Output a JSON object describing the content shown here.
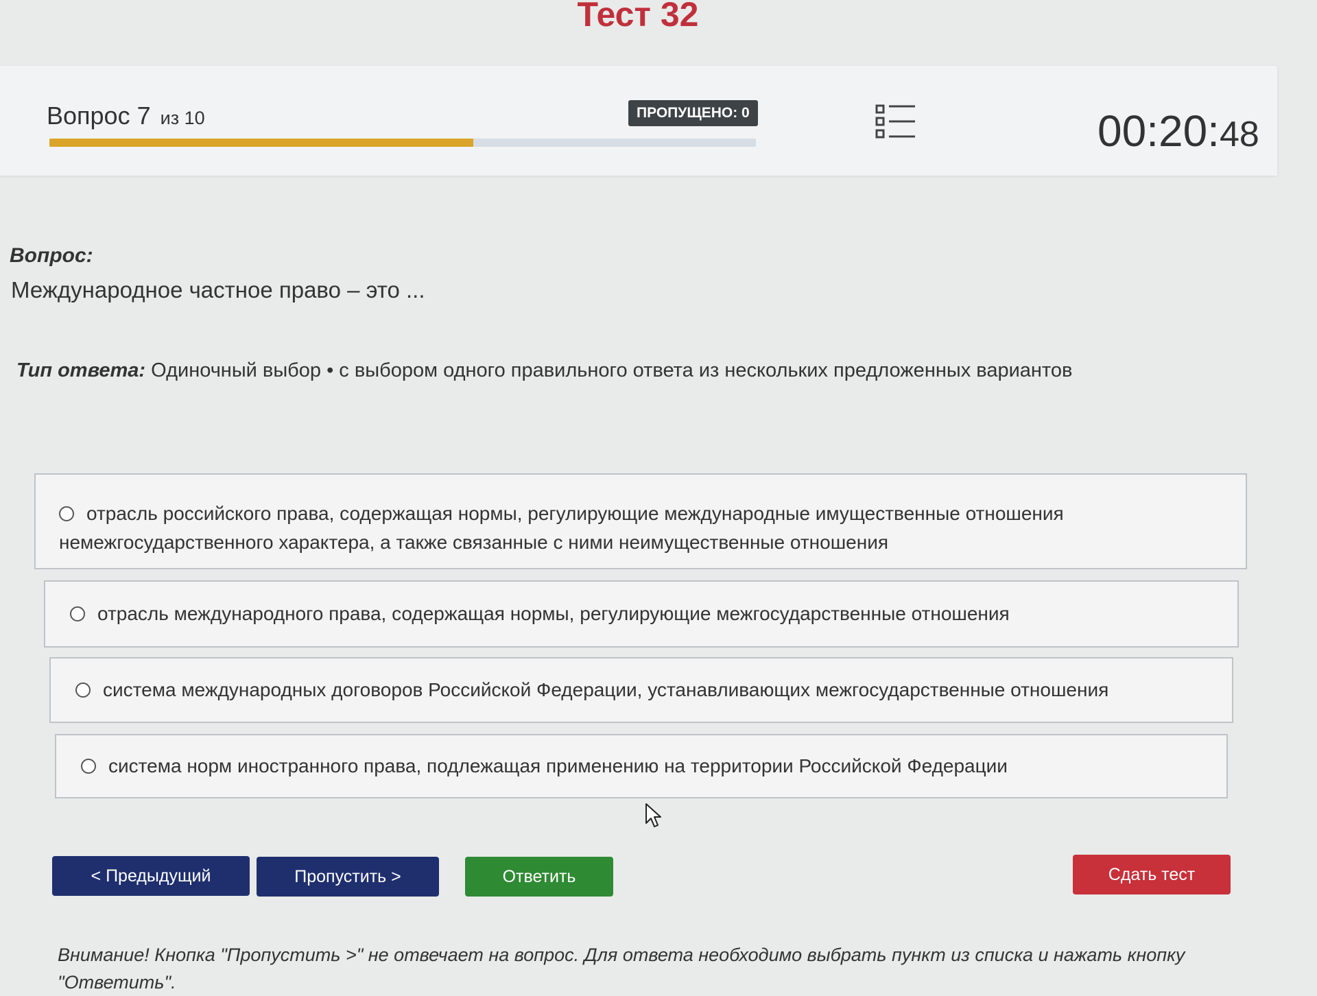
{
  "header": {
    "title": "Тест 32",
    "question_word": "Вопрос 7",
    "question_of": "из 10",
    "progress_fraction": 0.6,
    "skipped_label": "ПРОПУЩЕНО: 0",
    "timer_main": "00:20:",
    "timer_seconds": "48"
  },
  "question": {
    "label": "Вопрос:",
    "text": "Международное частное право – это ..."
  },
  "answer_type": {
    "label": "Тип ответа:",
    "value": "Одиночный выбор • с выбором одного правильного ответа из нескольких предложенных вариантов"
  },
  "options": [
    "отрасль российского права, содержащая нормы, регулирующие международные имущественные отношения немежгосударственного характера, а также связанные с ними неимущественные отношения",
    "отрасль международного права, содержащая нормы, регулирующие межгосударственные отношения",
    "система международных договоров Российской Федерации, устанавливающих межгосударственные отношения",
    "система норм иностранного права, подлежащая применению на территории Российской Федерации"
  ],
  "buttons": {
    "prev": "< Предыдущий",
    "skip": "Пропустить >",
    "answer": "Ответить",
    "submit": "Сдать тест"
  },
  "notice": "Внимание! Кнопка \"Пропустить >\" не отвечает на вопрос. Для ответа необходимо выбрать пункт из списка и нажать кнопку \"Ответить\".",
  "colors": {
    "title": "#c0303c",
    "progress": "#d9a428",
    "nav_button": "#1f2f6e",
    "answer_button": "#2f8a34",
    "submit_button": "#c8303a"
  },
  "icons": {
    "question_list": "list-icon",
    "cursor": "mouse-cursor-icon"
  }
}
